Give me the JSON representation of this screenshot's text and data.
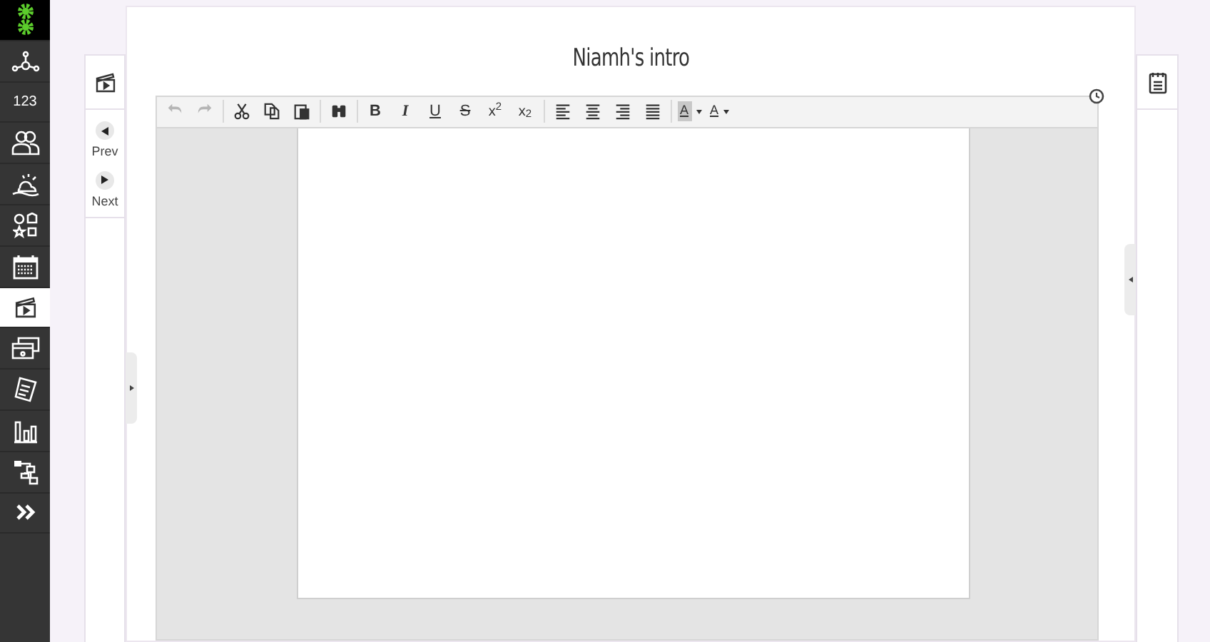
{
  "sidebar": {
    "items": [
      {
        "kind": "logo",
        "selected": false
      },
      {
        "kind": "network",
        "selected": false
      },
      {
        "kind": "number",
        "label": "123",
        "selected": false
      },
      {
        "kind": "people",
        "selected": false
      },
      {
        "kind": "weather",
        "selected": false
      },
      {
        "kind": "shapes",
        "selected": false
      },
      {
        "kind": "calendar",
        "selected": false
      },
      {
        "kind": "clapper",
        "selected": true
      },
      {
        "kind": "cards",
        "selected": false
      },
      {
        "kind": "notes",
        "selected": false
      },
      {
        "kind": "chart",
        "selected": false
      },
      {
        "kind": "tree",
        "selected": false
      },
      {
        "kind": "more",
        "selected": false
      }
    ]
  },
  "nav": {
    "prev": "Prev",
    "next": "Next"
  },
  "title": "Niamh's intro",
  "toolbar": [
    [
      {
        "kind": "undo",
        "disabled": true
      },
      {
        "kind": "redo",
        "disabled": true
      }
    ],
    [
      {
        "kind": "cut",
        "disabled": false
      },
      {
        "kind": "copy",
        "disabled": false
      },
      {
        "kind": "paste",
        "disabled": false
      }
    ],
    [
      {
        "kind": "find",
        "disabled": false
      }
    ],
    [
      {
        "kind": "bold",
        "label": "B",
        "disabled": false
      },
      {
        "kind": "italic",
        "label": "I",
        "disabled": false
      },
      {
        "kind": "underline",
        "label": "U",
        "disabled": false
      },
      {
        "kind": "strike",
        "label": "S",
        "disabled": false
      },
      {
        "kind": "sup",
        "label": "x$^{2}$",
        "disabled": false
      },
      {
        "kind": "sub",
        "label": "x$_{2}$",
        "disabled": false
      }
    ],
    [
      {
        "kind": "align-left",
        "disabled": false
      },
      {
        "kind": "align-center",
        "disabled": false
      },
      {
        "kind": "align-right",
        "disabled": false
      },
      {
        "kind": "justify",
        "disabled": false
      }
    ],
    [
      {
        "kind": "bgcolor",
        "label": "A",
        "disabled": false
      },
      {
        "kind": "fgcolor",
        "label": "A",
        "disabled": false
      }
    ]
  ]
}
